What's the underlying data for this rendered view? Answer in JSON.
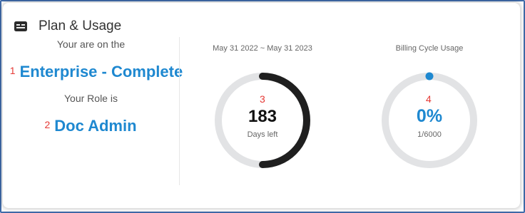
{
  "header": {
    "title": "Plan & Usage",
    "icon": "id-card-icon"
  },
  "plan": {
    "prefix": "Your are on the",
    "marker": "1",
    "name": "Enterprise - Complete"
  },
  "role": {
    "prefix": "Your Role is",
    "marker": "2",
    "name": "Doc Admin"
  },
  "subscription": {
    "range": "May 31 2022 ~ May 31 2023",
    "marker": "3",
    "days_left_value": "183",
    "days_left_label": "Days left",
    "progress_fraction": 0.5
  },
  "billing": {
    "label": "Billing Cycle Usage",
    "marker": "4",
    "percent": "0%",
    "count": "1/6000",
    "progress_fraction": 0.0
  },
  "colors": {
    "accent": "#1e88d0",
    "marker": "#e53935",
    "track": "#e2e3e5",
    "days_arc": "#1f1f1f",
    "frame": "#3f6aa8"
  }
}
